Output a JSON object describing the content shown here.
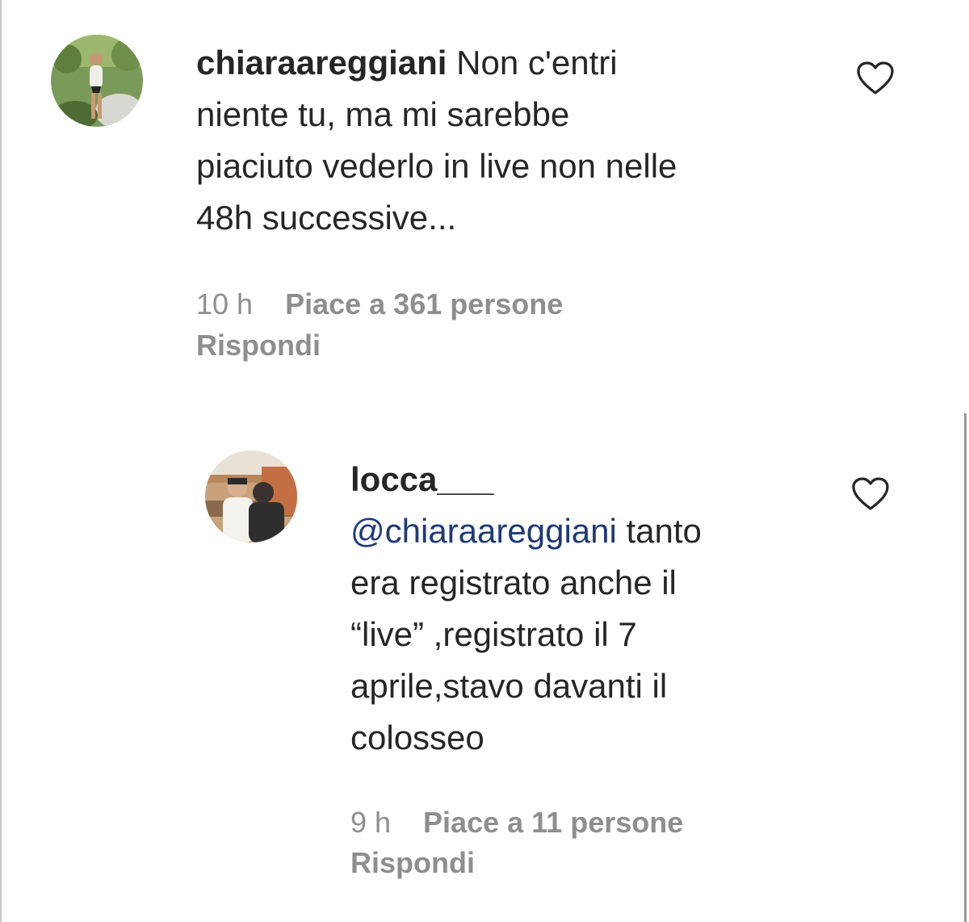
{
  "comments": [
    {
      "username": "chiaraareggiani",
      "text": " Non c'entri niente tu, ma mi sarebbe piaciuto vederlo in live non nelle 48h successive...",
      "line1": " Non c'entri",
      "line2": "niente tu, ma mi sarebbe",
      "line3": "piaciuto vederlo in live non nelle",
      "line4": "48h successive...",
      "time": "10 h",
      "likes": "Piace a 361 persone",
      "reply": "Rispondi",
      "avatar_icon": "avatar-photo"
    },
    {
      "username": "locca___",
      "mention": "@chiaraareggiani",
      "line1": " tanto",
      "line2": "era registrato anche il",
      "line3": "“live” ,registrato il 7",
      "line4": "aprile,stavo davanti il",
      "line5": "colosseo",
      "time": "9 h",
      "likes": "Piace a 11 persone",
      "reply": "Rispondi",
      "avatar_icon": "avatar-photo"
    }
  ],
  "icons": {
    "like": "heart-outline-icon"
  },
  "colors": {
    "text": "#262626",
    "meta": "#8e8e8e",
    "mention": "#1f3a75"
  }
}
